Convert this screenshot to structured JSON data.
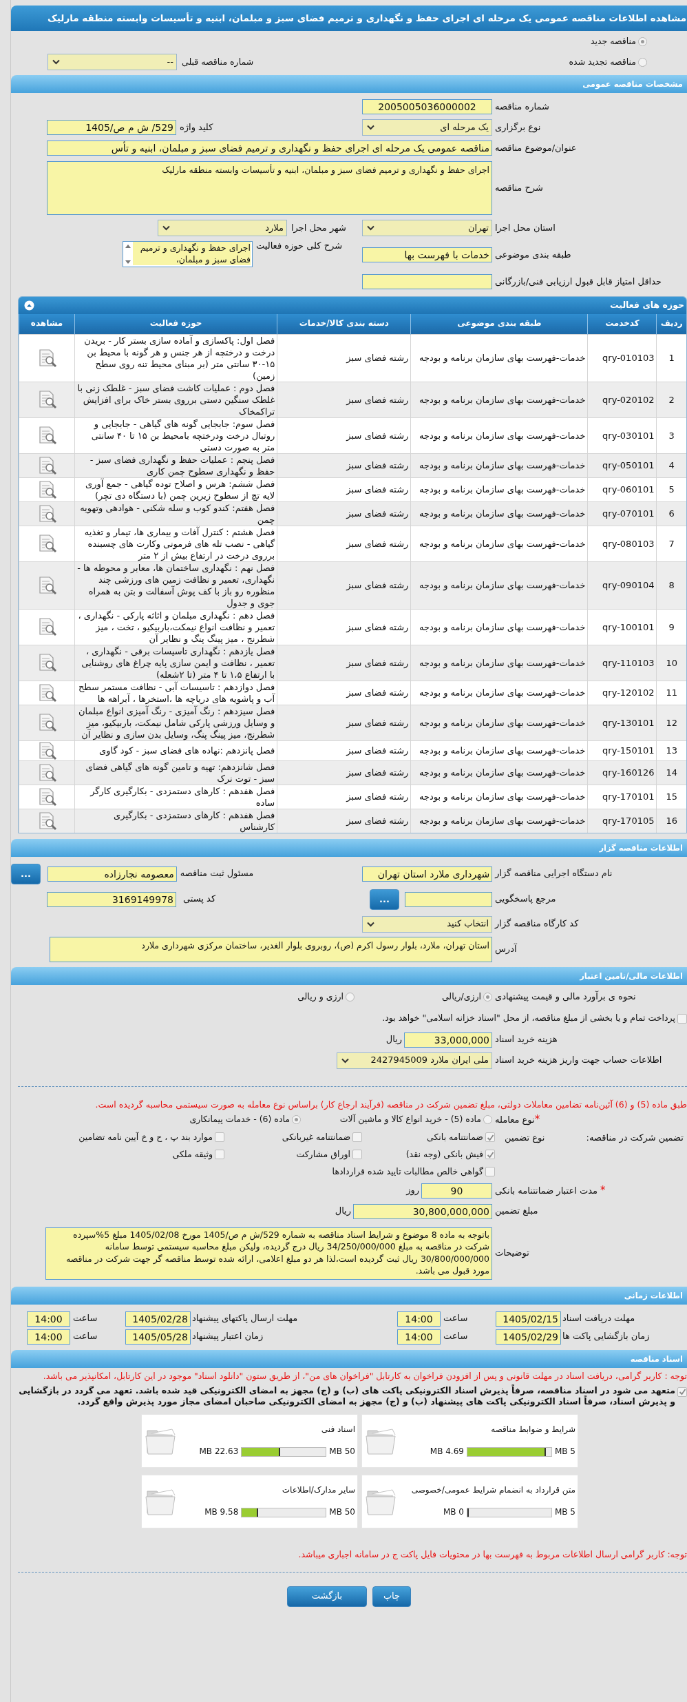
{
  "page_title": "مشاهده اطلاعات مناقصه عمومی یک مرحله ای اجرای حفظ و نگهداری و ترمیم فضای سبز و مبلمان، ابنیه و تأسیسات وابسته منطقه مارلیک",
  "tender_kind": [
    {
      "label": "مناقصه جدید",
      "selected": true
    },
    {
      "label": "مناقصه تجدید شده",
      "selected": false
    }
  ],
  "previous_tender": {
    "label": "شماره مناقصه قبلی",
    "value": "--"
  },
  "general": {
    "title": "مشخصات مناقصه عمومی",
    "tender_number": {
      "label": "شماره مناقصه",
      "value": "2005005036000002"
    },
    "holding_type": {
      "label": "نوع برگزاری",
      "value": "یک مرحله ای"
    },
    "keyword": {
      "label": "کلید واژه",
      "value": "529/ ش م ص/1405"
    },
    "subject": {
      "label": "عنوان/موضوع مناقصه",
      "value": "مناقصه عمومی یک مرحله ای اجرای حفظ و نگهداری و ترمیم فضای سبز و مبلمان، ابنیه و تأس"
    },
    "description": {
      "label": "شرح مناقصه",
      "value": "اجرای حفظ و نگهداری و ترمیم فضای سبز و مبلمان، ابنیه و تأسیسات وابسته منطقه مارلیک"
    },
    "province": {
      "label": "استان محل اجرا",
      "value": "تهران"
    },
    "city": {
      "label": "شهر محل اجرا",
      "value": "ملارد"
    },
    "subject_category": {
      "label": "طبقه بندی موضوعی",
      "value": "خدمات با فهرست بها"
    },
    "activity_scope": {
      "label": "شرح کلی حوزه فعالیت",
      "value": "اجرای حفظ و نگهداری و ترمیم فضای سبز و مبلمان،"
    },
    "min_score": {
      "label": "حداقل امتیاز قابل قبول ارزیابی فنی/بازرگانی"
    }
  },
  "activities": {
    "title": "حوزه های فعالیت",
    "columns": [
      "ردیف",
      "کدخدمت",
      "طبقه بندی موضوعی",
      "دسته بندی کالا/خدمات",
      "حوزه فعالیت",
      "مشاهده"
    ],
    "rows": [
      {
        "row": "1",
        "code": "qry-010103",
        "category": "خدمات-فهرست بهای سازمان برنامه و بودجه",
        "group": "رشته فضای سبز",
        "activity": "فصل اول:  پاکسازی و آماده سازی بستر کار - بریدن درخت و درختچه  از هر جنس و هر گونه با محیط بن ۱۵-۳۰ سانتی متر (بر مبنای محیط تنه روی سطح زمین)"
      },
      {
        "row": "2",
        "code": "qry-020102",
        "category": "خدمات-فهرست بهای سازمان برنامه و بودجه",
        "group": "رشته فضای سبز",
        "activity": "فصل دوم : عملیات کاشت فضای سبز - غلطک زنی با غلطک سنگین دستی برروی بستر خاک برای افزایش تراکمخاک"
      },
      {
        "row": "3",
        "code": "qry-030101",
        "category": "خدمات-فهرست بهای سازمان برنامه و بودجه",
        "group": "رشته فضای سبز",
        "activity": "فصل سوم: جابجایی گونه های گیاهی - جابجایی و روتبال درخت ودرختچه  بامحیط بن ۱۵ تا ۴۰ سانتی متر به صورت دستی"
      },
      {
        "row": "4",
        "code": "qry-050101",
        "category": "خدمات-فهرست بهای سازمان برنامه و بودجه",
        "group": "رشته فضای سبز",
        "activity": "فصل پنجم : عملیات حفظ و نگهداری فضای سبز - حفظ و نگهداری سطوح چمن کاری"
      },
      {
        "row": "5",
        "code": "qry-060101",
        "category": "خدمات-فهرست بهای سازمان برنامه و بودجه",
        "group": "رشته فضای سبز",
        "activity": "فصل ششم: هرس و اصلاح توده گیاهی - جمع آوری لایه تچ از سطوح زیرین چمن (با دستگاه دی تچر)"
      },
      {
        "row": "6",
        "code": "qry-070101",
        "category": "خدمات-فهرست بهای سازمان برنامه و بودجه",
        "group": "رشته فضای سبز",
        "activity": "فصل هفتم: کندو کوب و سله شکنی - هوادهی وتهویه چمن"
      },
      {
        "row": "7",
        "code": "qry-080103",
        "category": "خدمات-فهرست بهای سازمان برنامه و بودجه",
        "group": "رشته فضای سبز",
        "activity": "فصل هشتم : کنترل آفات و بیماری ها، تیمار و تغذیه گیاهی - نصب تله های فرمونی وکارت های چسبنده برروی درخت در ارتفاع بیش از ۲ متر"
      },
      {
        "row": "8",
        "code": "qry-090104",
        "category": "خدمات-فهرست بهای سازمان برنامه و بودجه",
        "group": "رشته فضای سبز",
        "activity": "فصل نهم : نگهداری ساختمان ها، معابر و محوطه ها - نگهداری، تعمیر و نظافت زمین های ورزشی چند منظوره رو باز با کف پوش آسفالت و بتن به همراه جوی و جدول"
      },
      {
        "row": "9",
        "code": "qry-100101",
        "category": "خدمات-فهرست بهای سازمان برنامه و بودجه",
        "group": "رشته فضای سبز",
        "activity": "فصل دهم : نگهداری مبلمان و اثاثه پارکی - نگهداری ، تعمیر و نظافت انواع  نیمکت،باربیکیو ، تخت ، میز شطرنج ، میز پینگ پنگ و نظایر آن"
      },
      {
        "row": "10",
        "code": "qry-110103",
        "category": "خدمات-فهرست بهای سازمان برنامه و بودجه",
        "group": "رشته فضای سبز",
        "activity": "فصل یازدهم : نگهداری تاسیسات برقی - نگهداری ، تعمیر ، نظافت و ایمن سازی پایه چراغ های روشنایی با ارتفاع ۱،۵ تا ۴ متر (تا  ۲شعله)"
      },
      {
        "row": "11",
        "code": "qry-120102",
        "category": "خدمات-فهرست بهای سازمان برنامه و بودجه",
        "group": "رشته فضای سبز",
        "activity": "فصل دوازدهم : تاسیسات آبی - نظافت مستمر سطح آب و پاشویه های دریاچه ها ،استخرها ، آبراهه ها"
      },
      {
        "row": "12",
        "code": "qry-130101",
        "category": "خدمات-فهرست بهای سازمان برنامه و بودجه",
        "group": "رشته فضای سبز",
        "activity": "فصل سیزدهم : رنگ آمیزی - رنگ آمیزی انواع مبلمان و وسایل ورزشی پارکی شامل نیمکت، باربیکیو، میز شطرنج، میز پینگ پنگ، وسایل بدن سازی و نظایر آن"
      },
      {
        "row": "13",
        "code": "qry-150101",
        "category": "خدمات-فهرست بهای سازمان برنامه و بودجه",
        "group": "رشته فضای سبز",
        "activity": "فصل پانزدهم :نهاده های فضای سبز -  کود گاوی"
      },
      {
        "row": "14",
        "code": "qry-160126",
        "category": "خدمات-فهرست بهای سازمان برنامه و بودجه",
        "group": "رشته فضای سبز",
        "activity": "فصل شانزدهم: تهیه و تامین گونه های گیاهی فضای سبز - توت نرک"
      },
      {
        "row": "15",
        "code": "qry-170101",
        "category": "خدمات-فهرست بهای سازمان برنامه و بودجه",
        "group": "رشته فضای سبز",
        "activity": "فصل هفدهم : کارهای دستمزدی - بکارگیری کارگر ساده"
      },
      {
        "row": "16",
        "code": "qry-170105",
        "category": "خدمات-فهرست بهای سازمان برنامه و بودجه",
        "group": "رشته فضای سبز",
        "activity": "فصل هفدهم : کارهای دستمزدی - بکارگیری کارشناس"
      }
    ]
  },
  "organizer": {
    "title": "اطلاعات مناقصه گزار",
    "executive": {
      "label": "نام دستگاه اجرایی مناقصه گزار",
      "value": "شهرداری ملارد استان تهران"
    },
    "registrar": {
      "label": "مسئول ثبت مناقصه",
      "value": "معصومه نجارزاده",
      "button": "..."
    },
    "reference": {
      "label": "مرجع پاسخگویی",
      "button": "..."
    },
    "postal_code": {
      "label": "کد پستی",
      "value": "3169149978"
    },
    "workshop_code": {
      "label": "کد کارگاه مناقصه گزار",
      "value": "انتخاب کنید"
    },
    "address": {
      "label": "آدرس",
      "value": "استان تهران، ملارد، بلوار رسول اکرم (ص)،  روبروی بلوار الغدیر، ساختمان مرکزی شهرداری ملارد"
    }
  },
  "finance": {
    "title": "اطلاعات مالی/تامین اعتبار",
    "estimate": {
      "label": "نحوه ی برآورد مالی و قیمت پیشنهادی",
      "options": [
        {
          "label": "ارزی/ریالی",
          "selected": true
        },
        {
          "label": "ارزی و ریالی",
          "selected": false
        }
      ]
    },
    "treasury": {
      "label": "پرداخت تمام و یا بخشی از مبلغ مناقصه، از محل \"اسناد خزانه اسلامی\" خواهد بود.",
      "checked": false
    },
    "doc_cost": {
      "label": "هزینه خرید اسناد",
      "value": "33,000,000",
      "unit": "ریال"
    },
    "account": {
      "label": "اطلاعات حساب جهت واریز هزینه خرید اسناد",
      "value": "ملی ایران ملارد 2427945009"
    },
    "notice": "طبق ماده (5) و (6) آئین‌نامه تضامین معاملات دولتی، مبلغ تضمین شرکت در مناقصه (فرآیند ارجاع کار) براساس نوع معامله به صورت سیستمی محاسبه گردیده است.",
    "deal_type": {
      "required_mark": "*",
      "label": "نوع معامله",
      "options": [
        {
          "label": "ماده (5) - خرید انواع کالا و ماشین آلات",
          "selected": false
        },
        {
          "label": "ماده (6) - خدمات پیمانکاری",
          "selected": true
        }
      ]
    },
    "guarantee": {
      "label": "تضمین شرکت در مناقصه:",
      "type_label": "نوع تضمین",
      "options": [
        {
          "label": "ضمانتنامه بانکی",
          "checked": true
        },
        {
          "label": "ضمانتنامه غیربانکی",
          "checked": false
        },
        {
          "label": "موارد بند پ ، ح و خ آیین نامه تضامین",
          "checked": false
        },
        {
          "label": "فیش بانکی (وجه نقد)",
          "checked": true
        },
        {
          "label": "اوراق مشارکت",
          "checked": false
        },
        {
          "label": "وثیقه ملکی",
          "checked": false
        },
        {
          "label": "گواهی خالص مطالبات تایید شده قراردادها",
          "checked": false
        }
      ]
    },
    "validity": {
      "required_mark": "*",
      "label": "مدت اعتبار ضمانتنامه بانکی",
      "value": "90",
      "unit": "روز"
    },
    "amount": {
      "label": "مبلغ تضمین",
      "value": "30,800,000,000",
      "unit": "ریال"
    },
    "notes": {
      "label": "توضیحات",
      "value": "باتوجه به ماده 8 موضوع و شرایط اسناد مناقصه به شماره 529/ش م ص/1405 مورخ 1405/02/08 مبلغ 5%سپرده شرکت در مناقصه به مبلغ 34/250/000/000 ریال درج گردیده، ولیکن مبلغ محاسبه سیستمی توسط سامانه 30/800/000/000 ریال ثبت گردیده است،لذا هر دو مبلغ اعلامی، ارائه شده توسط مناقصه گر جهت شرکت در مناقصه مورد قبول می باشد."
    }
  },
  "timing": {
    "title": "اطلاعات زمانی",
    "rows": [
      {
        "label": "مهلت دریافت اسناد",
        "date": "1405/02/15",
        "time_label": "ساعت",
        "time": "14:00"
      },
      {
        "label": "مهلت ارسال پاکتهای پیشنهاد",
        "date": "1405/02/28",
        "time_label": "ساعت",
        "time": "14:00"
      },
      {
        "label": "زمان بازگشایی پاکت ها",
        "date": "1405/02/29",
        "time_label": "ساعت",
        "time": "14:00"
      },
      {
        "label": "زمان اعتبار پیشنهاد",
        "date": "1405/05/28",
        "time_label": "ساعت",
        "time": "14:00"
      }
    ]
  },
  "documents": {
    "title": "اسناد مناقصه",
    "notice": "توجه : کاربر گرامی، دریافت اسناد در مهلت قانونی و پس از افزودن فراخوان به کارتابل \"فراخوان های من\"، از طریق ستون \"دانلود اسناد\" موجود در این کارتابل، امکانپذیر می باشد.",
    "commitment": {
      "text": "متعهد می شود در اسناد مناقصه، صرفاً پذیرش اسناد الکترونیکی پاکت های (ب) و (ج) مجهز به امضای الکترونیکی قید شده باشد. تعهد می گردد در بازگشایی و پذیرش اسناد، صرفاً اسناد الکترونیکی پاکت های پیشنهاد (ب) و (ج) مجهز به امضای الکترونیکی صاحبان امضای مجاز مورد پذیرش واقع گردد.",
      "checked": true
    },
    "files": [
      {
        "title": "شرایط و ضوابط مناقصه",
        "used": "4.69 MB",
        "max": "5 MB",
        "level": 0.938
      },
      {
        "title": "اسناد فنی",
        "used": "22.63 MB",
        "max": "50 MB",
        "level": 0.4526
      },
      {
        "title": "متن قرارداد به انضمام شرایط عمومی/خصوصی",
        "used": "0 MB",
        "max": "5 MB",
        "level": 0
      },
      {
        "title": "سایر مدارک/اطلاعات",
        "used": "9.58 MB",
        "max": "50 MB",
        "level": 0.1916
      }
    ],
    "note": "توجه: کاربر گرامی ارسال اطلاعات مربوط به فهرست بها در محتویات فایل پاکت ج در سامانه اجباری میباشد."
  },
  "buttons": [
    "چاپ",
    "بازگشت"
  ]
}
